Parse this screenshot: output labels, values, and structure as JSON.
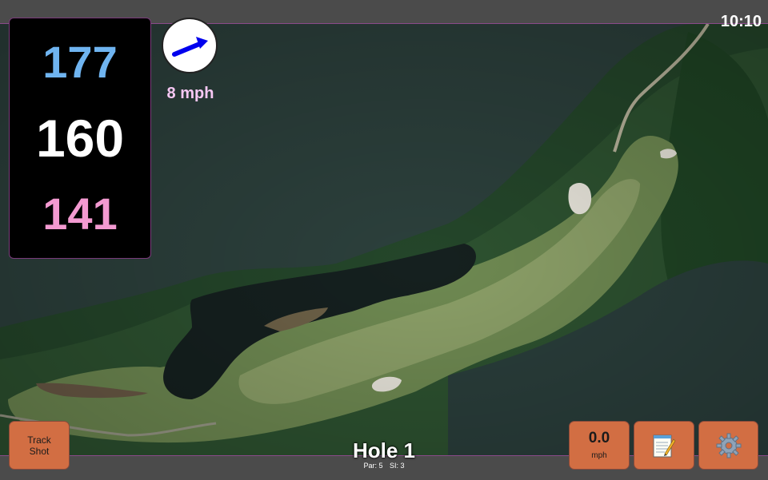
{
  "clock": {
    "time": "10:10"
  },
  "distances": {
    "back": "177",
    "middle": "160",
    "front": "141"
  },
  "wind": {
    "speed": "8 mph",
    "icon": "wind-direction-arrow-icon"
  },
  "buttons": {
    "track_shot": {
      "line1": "Track",
      "line2": "Shot"
    },
    "speed": {
      "value": "0.0",
      "unit": "mph"
    },
    "notes": {
      "icon": "notepad-icon"
    },
    "settings": {
      "icon": "gear-icon"
    }
  },
  "hole": {
    "title": "Hole 1",
    "par": "Par: 5",
    "si": "SI: 3"
  },
  "colors": {
    "back_distance": "#6fb4f0",
    "middle_distance": "#ffffff",
    "front_distance": "#f39ad1",
    "button_bg": "#d26e43",
    "wind_text": "#f6c7f3"
  }
}
